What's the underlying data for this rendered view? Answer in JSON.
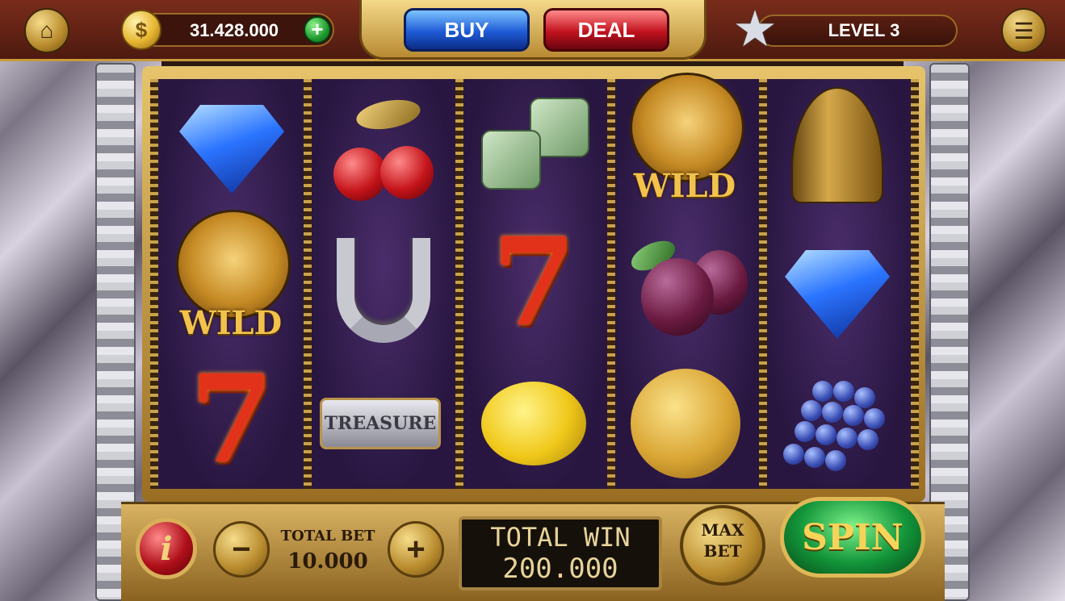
{
  "topbar": {
    "home_icon": "home-icon",
    "coin_symbol": "$",
    "coins": "31.428.000",
    "add_coins_symbol": "+",
    "buy_label": "BUY",
    "deal_label": "DEAL",
    "level_icon": "star-icon",
    "level": "LEVEL 3",
    "menu_icon": "menu-icon"
  },
  "reels": [
    [
      "blue diamond",
      "wild lion",
      "red seven"
    ],
    [
      "cherries",
      "horseshoe",
      "treasure"
    ],
    [
      "green dice",
      "red seven",
      "lemon"
    ],
    [
      "wild lion",
      "plums",
      "melon"
    ],
    [
      "bell",
      "blue diamond",
      "grapes"
    ]
  ],
  "symbol_text": {
    "wild": "WILD",
    "seven": "7",
    "treasure": "TREASURE"
  },
  "controls": {
    "info_symbol": "i",
    "minus_symbol": "−",
    "plus_symbol": "+",
    "total_bet_label": "TOTAL BET",
    "total_bet": "10.000",
    "total_win_label": "TOTAL WIN",
    "total_win": "200.000",
    "max_bet_label": "MAX BET",
    "spin_label": "SPIN"
  }
}
